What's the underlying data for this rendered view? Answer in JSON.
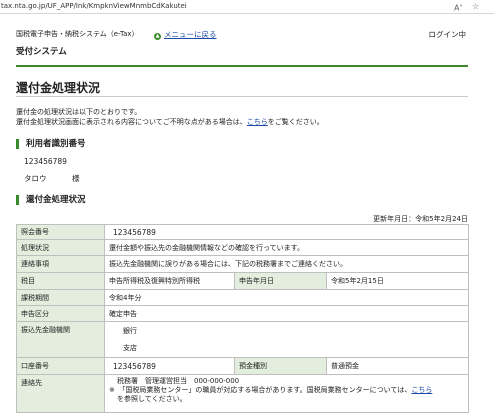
{
  "browser": {
    "url": "tax.nta.go.jp/UF_APP/lnk/KmpknViewMnmbCdKakutei"
  },
  "header": {
    "system_name": "国税電子申告・納税システム（e-Tax）",
    "back_to_menu": "メニューに戻る",
    "login_status": "ログイン中",
    "section_label": "受付システム"
  },
  "page": {
    "title": "還付金処理状況",
    "intro_line1": "還付金の処理状況は以下のとおりです。",
    "intro_line2_prefix": "還付金処理状況画面に表示される内容についてご不明な点がある場合は、",
    "intro_link": "こちら",
    "intro_line2_suffix": "をご覧ください。"
  },
  "user_section": {
    "heading": "利用者識別番号",
    "id_number": "123456789",
    "name": "タロウ",
    "honorific": "様"
  },
  "status_section": {
    "heading": "還付金処理状況",
    "updated": "更新年月日：令和5年2月24日",
    "rows": {
      "reference_label": "照会番号",
      "reference_value": "123456789",
      "processing_label": "処理状況",
      "processing_value": "還付金額や振込先の金融機関情報などの確認を行っています。",
      "notice_label": "連絡事項",
      "notice_value": "振込先金融機関に誤りがある場合には、下記の税務署までご連絡ください。",
      "tax_label": "税目",
      "tax_value": "申告所得税及復興特別所得税",
      "filing_date_label": "申告年月日",
      "filing_date_value": "令和5年2月15日",
      "period_label": "課税期間",
      "period_value": "令和4年分",
      "type_label": "申告区分",
      "type_value": "確定申告",
      "bank_label": "振込先金融機関",
      "bank_value1": "銀行",
      "bank_value2": "支店",
      "account_label": "口座番号",
      "account_value": "123456789",
      "deposit_type_label": "預金種別",
      "deposit_type_value": "普通預金",
      "contact_label": "連絡先",
      "contact_line1": "税務署　管理運営担当　000-000-000",
      "contact_line2_prefix": "※　「国税局業務センター」の職員が対応する場合があります。国税局業務センターについては、",
      "contact_link": "こちら",
      "contact_line3": "を参照してください。"
    }
  }
}
